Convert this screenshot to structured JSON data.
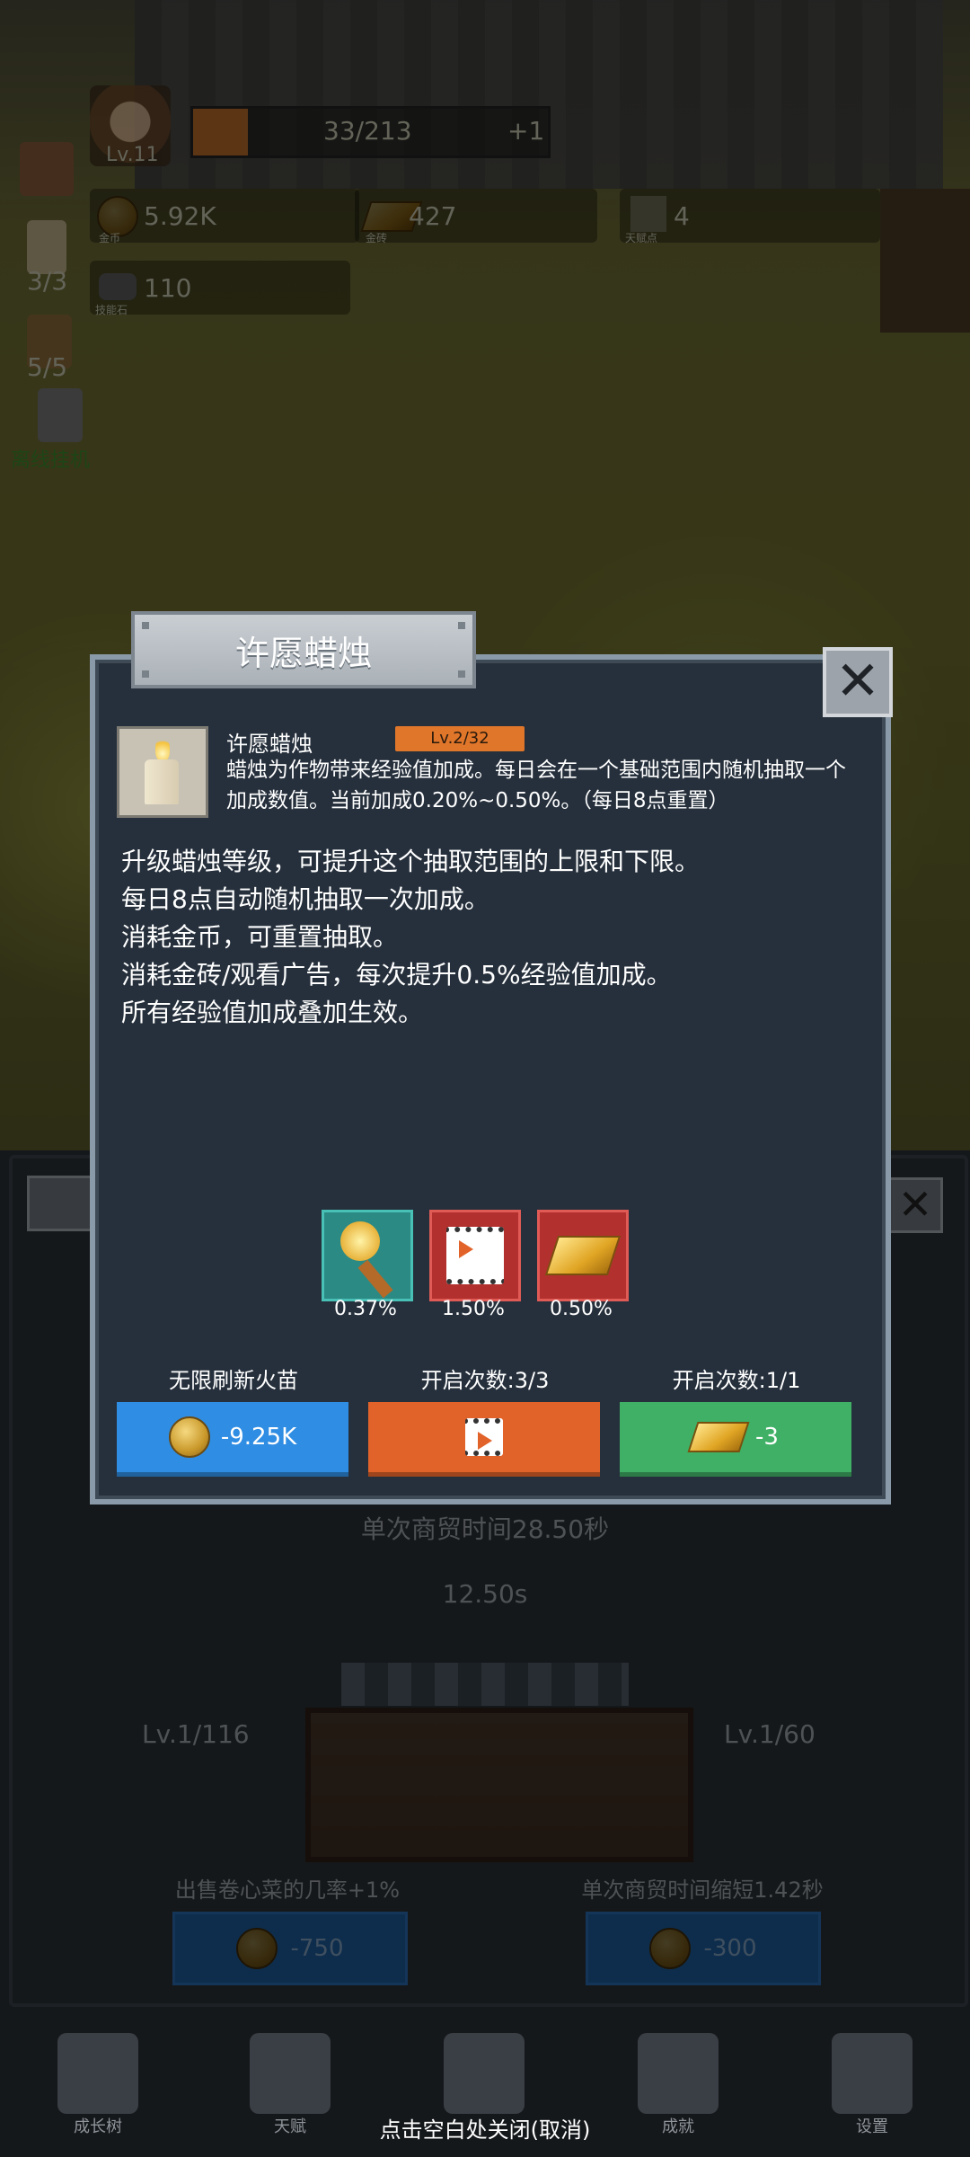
{
  "hud": {
    "level": "Lv.11",
    "xp_text": "33/213",
    "xp_fraction": 0.155,
    "xp_plus": "+1",
    "gold": {
      "value": "5.92K",
      "label": "金币"
    },
    "brick": {
      "value": "427",
      "label": "金砖"
    },
    "talent": {
      "value": "4",
      "label": "天赋点"
    },
    "stone": {
      "value": "110",
      "label": "技能石"
    },
    "candle_count": "3/3",
    "cup_count": "5/5",
    "idle_label": "离线挂机"
  },
  "dialog": {
    "title": "许愿蜡烛",
    "item_name": "许愿蜡烛",
    "item_level": "Lv.2/32",
    "desc": "蜡烛为作物带来经验值加成。每日会在一个基础范围内随机抽取一个加成数值。当前加成0.20%~0.50%。（每日8点重置）",
    "rules": [
      "升级蜡烛等级，可提升这个抽取范围的上限和下限。",
      "每日8点自动随机抽取一次加成。",
      "消耗金币，可重置抽取。",
      "消耗金砖/观看广告，每次提升0.5%经验值加成。",
      "所有经验值加成叠加生效。"
    ],
    "bonuses": [
      {
        "icon": "torch-icon",
        "value": "0.37%"
      },
      {
        "icon": "video-icon",
        "value": "1.50%"
      },
      {
        "icon": "gold-bar-icon",
        "value": "0.50%"
      }
    ],
    "actions": [
      {
        "label": "无限刷新火苗",
        "button": "-9.25K"
      },
      {
        "label": "开启次数:3/3",
        "button": ""
      },
      {
        "label": "开启次数:1/1",
        "button": "-3"
      }
    ],
    "colors": {
      "blue": "#2f8de3",
      "orange": "#e2632a",
      "green": "#3fb065"
    }
  },
  "background_panel": {
    "trade_time": "单次商贸时间28.50秒",
    "timer": "12.50s",
    "left_level": "Lv.1/116",
    "right_level": "Lv.1/60",
    "left_desc": "出售卷心菜的几率+1%",
    "right_desc": "单次商贸时间缩短1.42秒",
    "left_cost": "-750",
    "right_cost": "-300"
  },
  "nav": [
    "成长树",
    "天赋",
    "",
    "成就",
    "设置"
  ],
  "close_hint": "点击空白处关闭(取消)"
}
